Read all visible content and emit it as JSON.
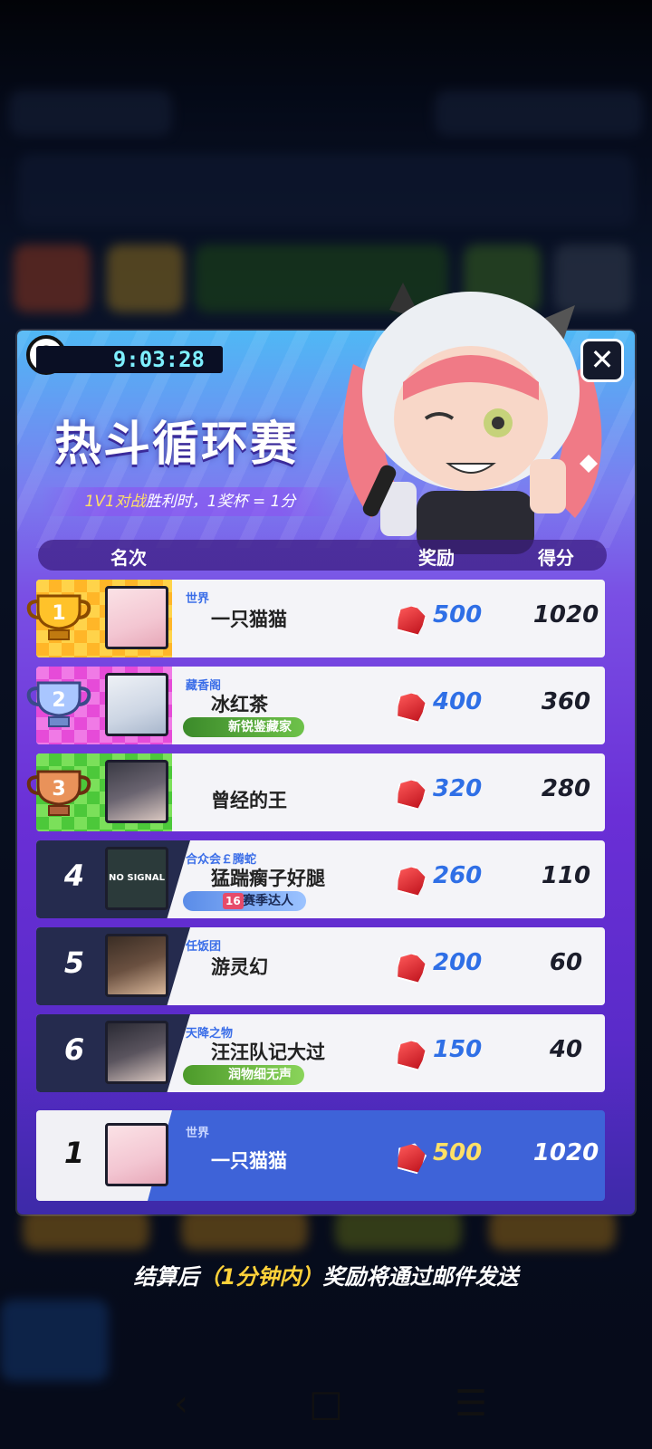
{
  "timer": "9:03:28",
  "title": "热斗循环赛",
  "rule": {
    "prefix": "1V1对战",
    "rest": "胜利时，1奖杯 = 1分"
  },
  "header": {
    "rank": "名次",
    "reward": "奖励",
    "score": "得分"
  },
  "rows": [
    {
      "rank": "1",
      "guild": "世界",
      "name": "一只猫猫",
      "badge": "",
      "reward": "500",
      "score": "1020"
    },
    {
      "rank": "2",
      "guild": "藏香阁",
      "name": "冰红茶",
      "badge": "新锐鉴藏家",
      "reward": "400",
      "score": "360"
    },
    {
      "rank": "3",
      "guild": "",
      "name": "曾经的王",
      "badge": "",
      "reward": "320",
      "score": "280"
    },
    {
      "rank": "4",
      "guild": "合众会￡腾蛇",
      "name": "猛踹瘸子好腿",
      "badge": "赛季达人",
      "badge_prefix": "16",
      "reward": "260",
      "score": "110"
    },
    {
      "rank": "5",
      "guild": "任饭团",
      "name": "游灵幻",
      "badge": "",
      "reward": "200",
      "score": "60"
    },
    {
      "rank": "6",
      "guild": "天降之物",
      "name": "汪汪队记大过",
      "badge": "润物细无声",
      "reward": "150",
      "score": "40"
    }
  ],
  "self": {
    "rank": "1",
    "guild": "世界",
    "name": "一只猫猫",
    "reward": "500",
    "score": "1020"
  },
  "avatar4_text": "NO SIGNAL",
  "notice": {
    "a": "结算后",
    "b": "（1分钟内）",
    "c": "奖励将通过邮件发送"
  },
  "nav": {
    "back": "‹",
    "home": "□",
    "menu": "☰"
  },
  "colors": {
    "accent": "#3e63d8",
    "gem": "#d8202a",
    "reward_text": "#2f6fe6",
    "highlight": "#ffe066"
  }
}
